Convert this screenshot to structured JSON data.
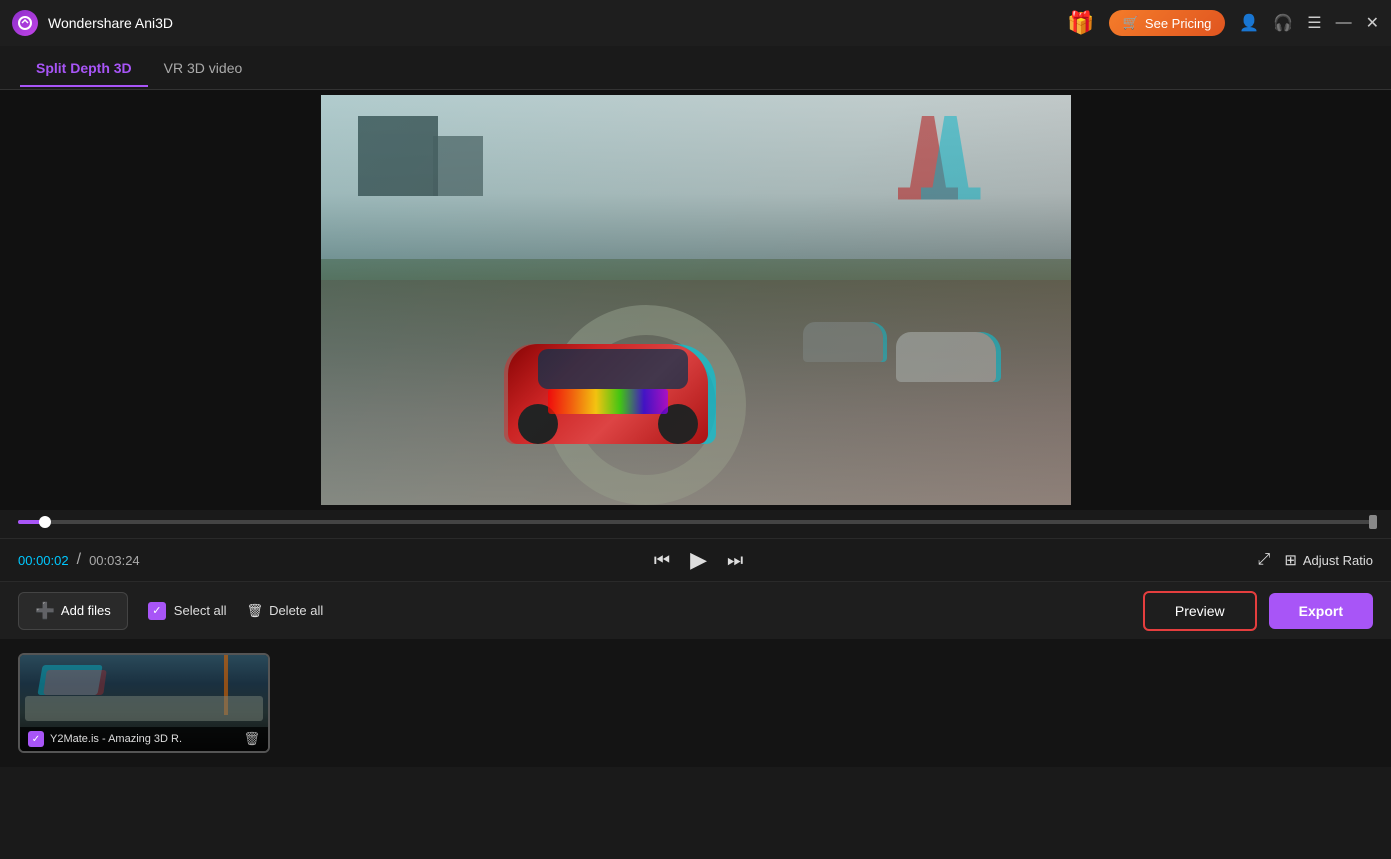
{
  "titleBar": {
    "appName": "Wondershare Ani3D",
    "seePricingLabel": "See Pricing",
    "windowControls": {
      "minimize": "—",
      "close": "✕"
    }
  },
  "tabs": [
    {
      "id": "split-depth",
      "label": "Split Depth 3D",
      "active": true
    },
    {
      "id": "vr-3d",
      "label": "VR 3D video",
      "active": false
    }
  ],
  "controls": {
    "currentTime": "00:00:02",
    "totalTime": "00:03:24",
    "separator": "/",
    "adjustRatioLabel": "Adjust Ratio"
  },
  "toolbar": {
    "addFilesLabel": "Add files",
    "selectAllLabel": "Select all",
    "deleteAllLabel": "Delete all",
    "previewLabel": "Preview",
    "exportLabel": "Export"
  },
  "files": [
    {
      "name": "Y2Mate.is - Amazing 3D R.",
      "checked": true
    }
  ],
  "scrubber": {
    "fillPercent": 2
  }
}
